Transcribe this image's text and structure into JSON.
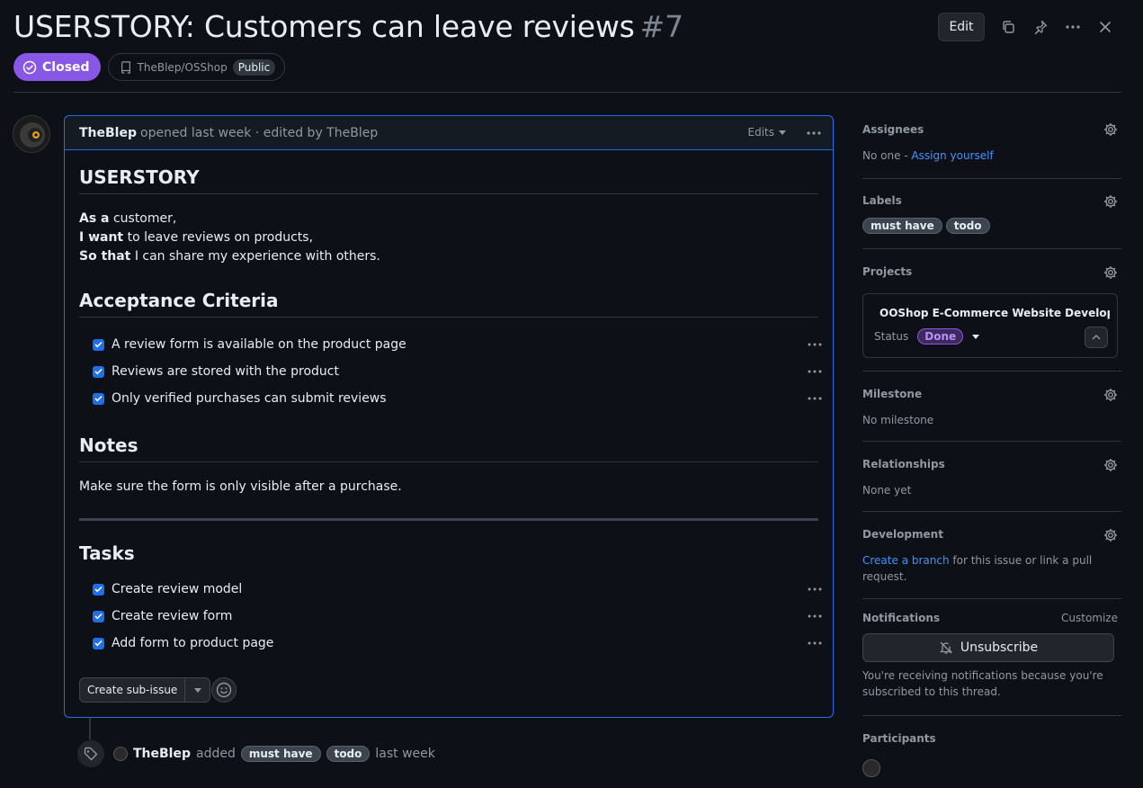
{
  "issue": {
    "title": "USERSTORY: Customers can leave reviews",
    "number": "#7",
    "state": "Closed",
    "repo": "TheBlep/OSShop",
    "visibility": "Public"
  },
  "header_actions": {
    "edit_label": "Edit"
  },
  "comment": {
    "author": "TheBlep",
    "meta": "opened last week · edited by TheBlep",
    "edits_label": "Edits",
    "heading_story": "USERSTORY",
    "story": [
      {
        "bold": "As a",
        "text": " customer,"
      },
      {
        "bold": "I want",
        "text": " to leave reviews on products,"
      },
      {
        "bold": "So that",
        "text": " I can share my experience with others."
      }
    ],
    "heading_criteria": "Acceptance Criteria",
    "criteria": [
      "A review form is available on the product page",
      "Reviews are stored with the product",
      "Only verified purchases can submit reviews"
    ],
    "heading_notes": "Notes",
    "notes": "Make sure the form is only visible after a purchase.",
    "heading_tasks": "Tasks",
    "tasks": [
      "Create review model",
      "Create review form",
      "Add form to product page"
    ],
    "create_sub_issue": "Create sub-issue"
  },
  "timeline": {
    "actor": "TheBlep",
    "action": "added",
    "labels": [
      "must have",
      "todo"
    ],
    "when": "last week"
  },
  "sidebar": {
    "assignees": {
      "heading": "Assignees",
      "value": "No one - ",
      "link": "Assign yourself"
    },
    "labels": {
      "heading": "Labels",
      "items": [
        "must have",
        "todo"
      ]
    },
    "projects": {
      "heading": "Projects",
      "project_name": "OOShop E-Commerce Website Develop...",
      "status_label": "Status",
      "status_value": "Done"
    },
    "milestone": {
      "heading": "Milestone",
      "value": "No milestone"
    },
    "relationships": {
      "heading": "Relationships",
      "value": "None yet"
    },
    "development": {
      "heading": "Development",
      "link": "Create a branch",
      "text": " for this issue or link a pull request."
    },
    "notifications": {
      "heading": "Notifications",
      "customize": "Customize",
      "button": "Unsubscribe",
      "reason": "You're receiving notifications because you're subscribed to this thread."
    },
    "participants": {
      "heading": "Participants"
    }
  },
  "colors": {
    "closed": "#8957e5",
    "link": "#4493f8",
    "checkbox": "#1f6feb",
    "bg": "#0d1117"
  }
}
